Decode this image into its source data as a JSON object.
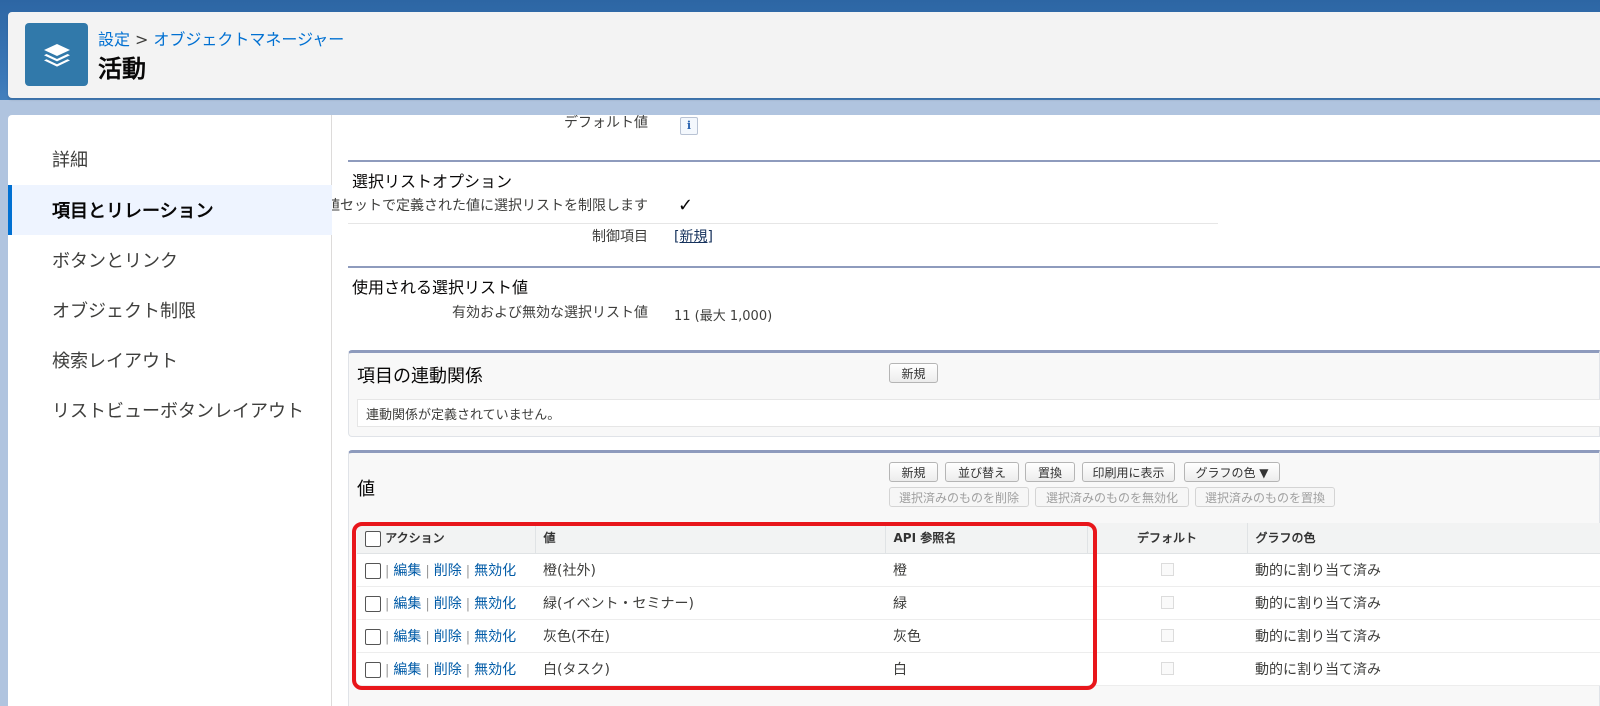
{
  "header": {
    "breadcrumb_setup": "設定",
    "breadcrumb_sep": ">",
    "breadcrumb_object_manager": "オブジェクトマネージャー",
    "title": "活動",
    "icon": "layers-icon"
  },
  "sidebar": {
    "items": [
      {
        "label": "詳細",
        "active": false
      },
      {
        "label": "項目とリレーション",
        "active": true
      },
      {
        "label": "ボタンとリンク",
        "active": false
      },
      {
        "label": "オブジェクト制限",
        "active": false
      },
      {
        "label": "検索レイアウト",
        "active": false
      },
      {
        "label": "リストビューボタンレイアウト",
        "active": false
      }
    ]
  },
  "detail": {
    "default_value_label": "デフォルト値",
    "info_icon": "i",
    "picklist_options_title": "選択リストオプション",
    "restrict_label": "値セットで定義された値に選択リストを制限します",
    "restrict_check": "✓",
    "controlling_field_label": "制御項目",
    "controlling_field_link": "[新規]",
    "used_values_title": "使用される選択リスト値",
    "active_inactive_label": "有効および無効な選択リスト値",
    "active_inactive_value": "11 (最大 1,000)"
  },
  "dependencies": {
    "title": "項目の連動関係",
    "new_button": "新規",
    "empty_message": "連動関係が定義されていません。"
  },
  "values": {
    "title": "値",
    "buttons": {
      "new": "新規",
      "reorder": "並び替え",
      "replace": "置換",
      "printable": "印刷用に表示",
      "chart_colors": "グラフの色 ▼",
      "delete_selected": "選択済みのものを削除",
      "deactivate_selected": "選択済みのものを無効化",
      "replace_selected": "選択済みのものを置換"
    },
    "columns": {
      "action": "アクション",
      "value": "値",
      "api_name": "API 参照名",
      "default": "デフォルト",
      "chart_color": "グラフの色"
    },
    "action_links": {
      "edit": "編集",
      "delete": "削除",
      "deactivate": "無効化",
      "pipe": "|"
    },
    "rows": [
      {
        "value": "橙(社外)",
        "api_name": "橙",
        "chart_color": "動的に割り当て済み"
      },
      {
        "value": "緑(イベント・セミナー)",
        "api_name": "緑",
        "chart_color": "動的に割り当て済み"
      },
      {
        "value": "灰色(不在)",
        "api_name": "灰色",
        "chart_color": "動的に割り当て済み"
      },
      {
        "value": "白(タスク)",
        "api_name": "白",
        "chart_color": "動的に割り当て済み"
      }
    ]
  },
  "colors": {
    "brand_blue": "#3179aa",
    "link_blue": "#0070d2",
    "highlight_red": "#e8161b"
  }
}
